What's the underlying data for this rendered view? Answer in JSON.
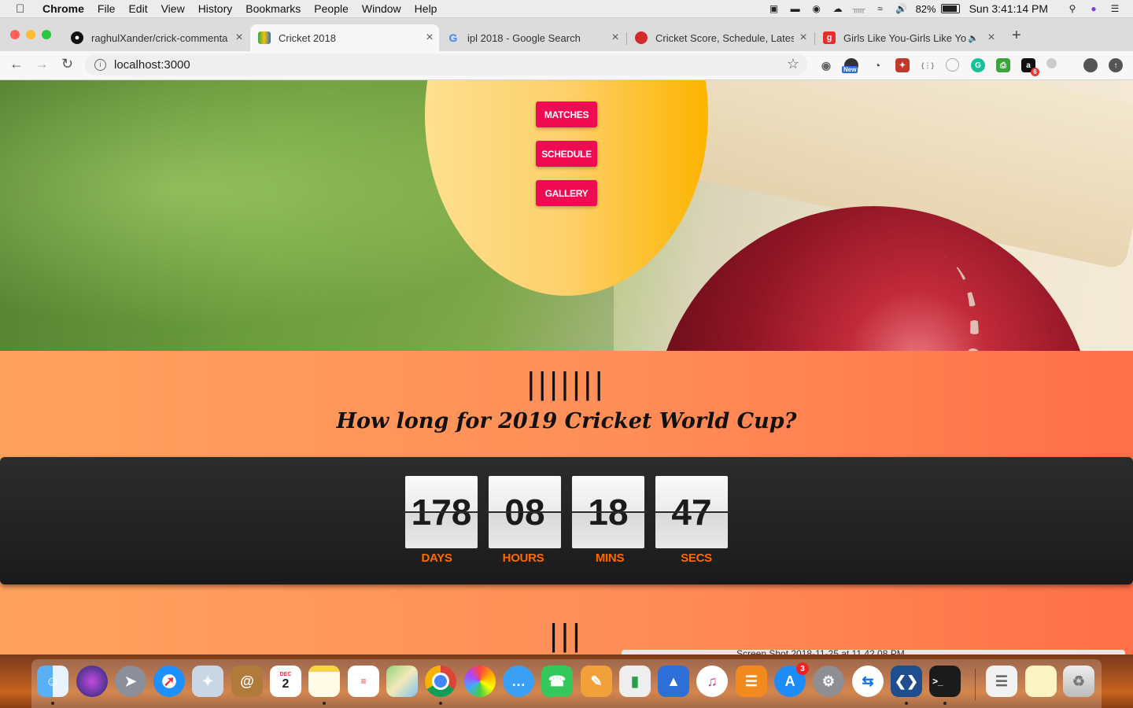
{
  "menubar": {
    "app": "Chrome",
    "items": [
      "File",
      "Edit",
      "View",
      "History",
      "Bookmarks",
      "People",
      "Window",
      "Help"
    ],
    "battery_pct": "82%",
    "battery_level": 0.82,
    "clock": "Sun 3:41:14 PM"
  },
  "tabs": [
    {
      "title": "raghulXander/crick-commenta",
      "icon": "github-icon",
      "active": false
    },
    {
      "title": "Cricket 2018",
      "icon": "cricket-favicon",
      "active": true
    },
    {
      "title": "ipl 2018 - Google Search",
      "icon": "google-icon",
      "active": false
    },
    {
      "title": "Cricket Score, Schedule, Lates",
      "icon": "cricbuzz-icon",
      "active": false
    },
    {
      "title": "Girls Like You-Girls Like Yo",
      "icon": "gaana-icon",
      "active": false
    }
  ],
  "toolbar": {
    "url": "localhost:3000",
    "new_badge": "New",
    "ext_badge_count": "6"
  },
  "nav": {
    "matches": "MATCHES",
    "schedule": "SCHEDULE",
    "gallery": "GALLERY"
  },
  "countdown": {
    "tally_top": "|||||||",
    "headline": "How long for 2019 Cricket World Cup?",
    "units": [
      {
        "value": "178",
        "label": "DAYS"
      },
      {
        "value": "08",
        "label": "HOURS"
      },
      {
        "value": "18",
        "label": "MINS"
      },
      {
        "value": "47",
        "label": "SECS"
      }
    ],
    "tally_bottom": "|||"
  },
  "dock": {
    "calendar_month": "DEC",
    "calendar_day": "2",
    "appstore_badge": "3",
    "peek_title": "Screen Shot 2018-11-25 at 11.42.08 PM"
  },
  "colors": {
    "accent_pink": "#ef0a52",
    "label_orange": "#ff6a00",
    "circle_yellow": "#fdb400"
  }
}
